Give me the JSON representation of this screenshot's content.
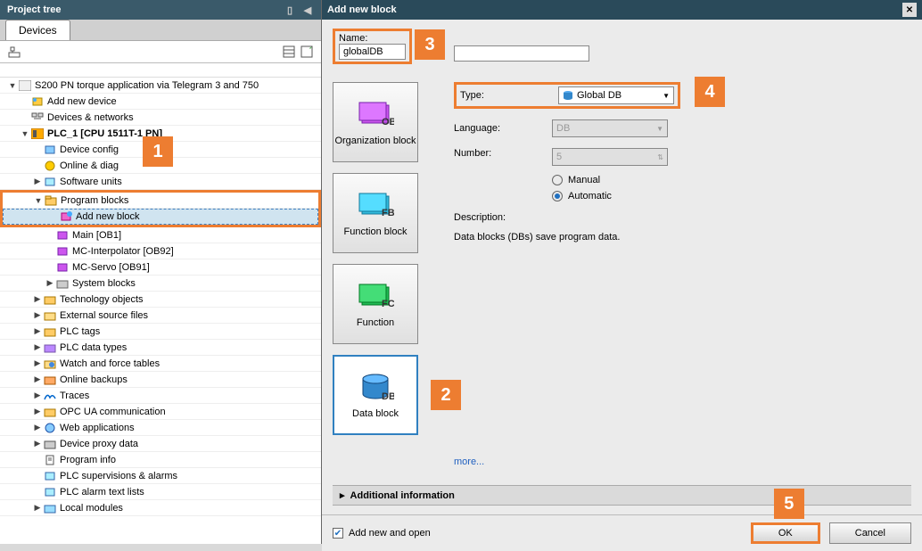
{
  "leftPanel": {
    "title": "Project tree",
    "tab": "Devices",
    "tree": {
      "root": "S200 PN torque application via Telegram 3 and 750",
      "addDevice": "Add new device",
      "devicesNetworks": "Devices & networks",
      "plc": "PLC_1 [CPU 1511T-1 PN]",
      "deviceConfig": "Device config",
      "onlineDiag": "Online & diag",
      "softwareUnits": "Software units",
      "programBlocks": "Program blocks",
      "addNewBlock": "Add new block",
      "main": "Main [OB1]",
      "mcInterpolator": "MC-Interpolator [OB92]",
      "mcServo": "MC-Servo [OB91]",
      "systemBlocks": "System blocks",
      "techObjects": "Technology objects",
      "externalSource": "External source files",
      "plcTags": "PLC tags",
      "plcDataTypes": "PLC data types",
      "watchForce": "Watch and force tables",
      "onlineBackups": "Online backups",
      "traces": "Traces",
      "opcUa": "OPC UA communication",
      "webApps": "Web applications",
      "deviceProxy": "Device proxy data",
      "programInfo": "Program info",
      "plcSupervisions": "PLC supervisions & alarms",
      "plcAlarmText": "PLC alarm text lists",
      "localModules": "Local modules"
    }
  },
  "dialog": {
    "title": "Add new block",
    "nameLabel": "Name:",
    "nameValue": "globalDB",
    "blockTypes": {
      "ob": "Organization block",
      "fb": "Function block",
      "fc": "Function",
      "db": "Data block"
    },
    "props": {
      "typeLabel": "Type:",
      "typeValue": "Global DB",
      "languageLabel": "Language:",
      "languageValue": "DB",
      "numberLabel": "Number:",
      "numberValue": "5",
      "manual": "Manual",
      "automatic": "Automatic"
    },
    "descriptionLabel": "Description:",
    "descriptionText": "Data blocks (DBs) save program data.",
    "moreLink": "more...",
    "additionalInfo": "Additional information",
    "addNewOpen": "Add new and open",
    "ok": "OK",
    "cancel": "Cancel"
  },
  "callouts": {
    "c1": "1",
    "c2": "2",
    "c3": "3",
    "c4": "4",
    "c5": "5"
  }
}
